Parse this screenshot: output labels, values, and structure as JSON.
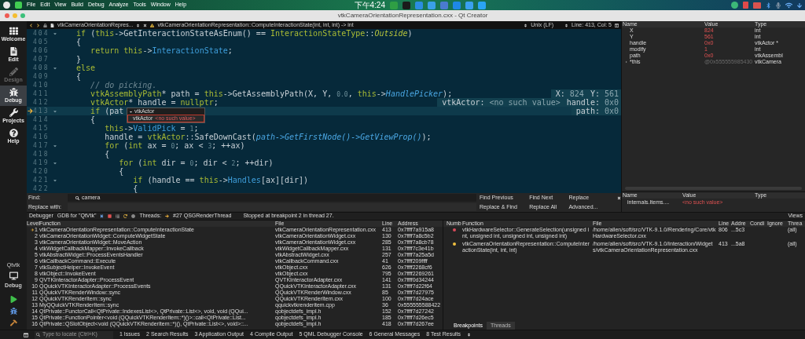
{
  "system_bar": {
    "menu": [
      "File",
      "Edit",
      "View",
      "Build",
      "Debug",
      "Analyze",
      "Tools",
      "Window",
      "Help"
    ],
    "clock": "下午4:24"
  },
  "window": {
    "title": "vtkCameraOrientationRepresentation.cxx - Qt Creator"
  },
  "modes": [
    {
      "label": "Welcome",
      "kind": "welcome",
      "selected": false,
      "disabled": false
    },
    {
      "label": "Edit",
      "kind": "edit",
      "selected": false,
      "disabled": false
    },
    {
      "label": "Design",
      "kind": "design",
      "selected": false,
      "disabled": true
    },
    {
      "label": "Debug",
      "kind": "debug",
      "selected": true,
      "disabled": false
    },
    {
      "label": "Projects",
      "kind": "projects",
      "selected": false,
      "disabled": false
    },
    {
      "label": "Help",
      "kind": "help",
      "selected": false,
      "disabled": false
    }
  ],
  "target": {
    "project": "Qtvtk",
    "config": "Debug"
  },
  "editor": {
    "file": "vtkCameraOrientationRepres...",
    "symbol": "vtkCameraOrientationRepresentation::ComputeInteractionState(int, int, int) -> int",
    "line_ending": "Unix (LF)",
    "position": "Line: 413, Col: 5",
    "lines": [
      {
        "number": "404",
        "fold": true,
        "tokens": [
          {
            "text": "   if",
            "kind": "keyword"
          },
          {
            "text": " (",
            "kind": "plain"
          },
          {
            "text": "this",
            "kind": "keyword"
          },
          {
            "text": "->GetInteractionStateAsEnum() == ",
            "kind": "plain"
          },
          {
            "text": "InteractionStateType",
            "kind": "type"
          },
          {
            "text": "::",
            "kind": "plain"
          },
          {
            "text": "Outside",
            "kind": "enum"
          },
          {
            "text": ")",
            "kind": "plain"
          }
        ]
      },
      {
        "number": "405",
        "fold": false,
        "tokens": [
          {
            "text": "   {",
            "kind": "plain"
          }
        ]
      },
      {
        "number": "406",
        "fold": false,
        "tokens": [
          {
            "text": "      return ",
            "kind": "keyword"
          },
          {
            "text": "this",
            "kind": "keyword"
          },
          {
            "text": "->",
            "kind": "plain"
          },
          {
            "text": "InteractionState",
            "kind": "member"
          },
          {
            "text": ";",
            "kind": "plain"
          }
        ]
      },
      {
        "number": "407",
        "fold": false,
        "tokens": [
          {
            "text": "   }",
            "kind": "plain"
          }
        ]
      },
      {
        "number": "408",
        "fold": true,
        "tokens": [
          {
            "text": "   else",
            "kind": "keyword"
          }
        ]
      },
      {
        "number": "409",
        "fold": false,
        "tokens": [
          {
            "text": "   {",
            "kind": "plain"
          }
        ]
      },
      {
        "number": "410",
        "fold": false,
        "tokens": [
          {
            "text": "      // do picking.",
            "kind": "comment"
          }
        ]
      },
      {
        "number": "411",
        "fold": false,
        "tokens": [
          {
            "text": "      vtkAssemblyPath",
            "kind": "type"
          },
          {
            "text": "* path = ",
            "kind": "plain"
          },
          {
            "text": "this",
            "kind": "keyword"
          },
          {
            "text": "->GetAssemblyPath(X, Y, ",
            "kind": "plain"
          },
          {
            "text": "0.0",
            "kind": "number"
          },
          {
            "text": ", ",
            "kind": "plain"
          },
          {
            "text": "this",
            "kind": "keyword"
          },
          {
            "text": "->",
            "kind": "plain"
          },
          {
            "text": "HandlePicker",
            "kind": "virtual"
          },
          {
            "text": ");",
            "kind": "plain"
          }
        ],
        "annotations": [
          {
            "label": "X:",
            "value": "824"
          },
          {
            "label": "Y:",
            "value": "561"
          }
        ]
      },
      {
        "number": "412",
        "fold": false,
        "tokens": [
          {
            "text": "      vtkActor",
            "kind": "type"
          },
          {
            "text": "* handle = ",
            "kind": "plain"
          },
          {
            "text": "nullptr",
            "kind": "keyword"
          },
          {
            "text": ";",
            "kind": "plain"
          }
        ],
        "annotations": [
          {
            "label": "vtkActor:",
            "value": "<no such value>"
          },
          {
            "label": "handle:",
            "value": "0x0"
          }
        ]
      },
      {
        "number": "413",
        "fold": true,
        "breakpoint": true,
        "current": true,
        "tokens": [
          {
            "text": "      if",
            "kind": "keyword"
          },
          {
            "text": " (pat",
            "kind": "plain"
          }
        ],
        "annotations": [
          {
            "label": "path:",
            "value": "0x0"
          }
        ],
        "popup": {
          "header": "vtkActor",
          "rows": [
            {
              "name": "vtkActor",
              "value": "<no such value>"
            }
          ]
        }
      },
      {
        "number": "414",
        "fold": false,
        "tokens": [
          {
            "text": "      {",
            "kind": "plain"
          }
        ]
      },
      {
        "number": "415",
        "fold": false,
        "tokens": [
          {
            "text": "         this",
            "kind": "keyword"
          },
          {
            "text": "->",
            "kind": "plain"
          },
          {
            "text": "ValidPick",
            "kind": "member"
          },
          {
            "text": " = ",
            "kind": "plain"
          },
          {
            "text": "1",
            "kind": "number"
          },
          {
            "text": ";",
            "kind": "plain"
          }
        ]
      },
      {
        "number": "416",
        "fold": false,
        "tokens": [
          {
            "text": "         handle = ",
            "kind": "plain"
          },
          {
            "text": "vtkActor",
            "kind": "type"
          },
          {
            "text": "::SafeDownCast(",
            "kind": "plain"
          },
          {
            "text": "path->GetFirstNode()->GetViewProp()",
            "kind": "virtual"
          },
          {
            "text": ");",
            "kind": "plain"
          }
        ]
      },
      {
        "number": "417",
        "fold": true,
        "tokens": [
          {
            "text": "         for",
            "kind": "keyword"
          },
          {
            "text": " (",
            "kind": "plain"
          },
          {
            "text": "int",
            "kind": "keyword"
          },
          {
            "text": " ax = ",
            "kind": "plain"
          },
          {
            "text": "0",
            "kind": "number"
          },
          {
            "text": "; ax < ",
            "kind": "plain"
          },
          {
            "text": "3",
            "kind": "number"
          },
          {
            "text": "; ++ax)",
            "kind": "plain"
          }
        ]
      },
      {
        "number": "418",
        "fold": false,
        "tokens": [
          {
            "text": "         {",
            "kind": "plain"
          }
        ]
      },
      {
        "number": "419",
        "fold": true,
        "tokens": [
          {
            "text": "            for",
            "kind": "keyword"
          },
          {
            "text": " (",
            "kind": "plain"
          },
          {
            "text": "int",
            "kind": "keyword"
          },
          {
            "text": " dir = ",
            "kind": "plain"
          },
          {
            "text": "0",
            "kind": "number"
          },
          {
            "text": "; dir < ",
            "kind": "plain"
          },
          {
            "text": "2",
            "kind": "number"
          },
          {
            "text": "; ++dir)",
            "kind": "plain"
          }
        ]
      },
      {
        "number": "420",
        "fold": false,
        "tokens": [
          {
            "text": "            {",
            "kind": "plain"
          }
        ]
      },
      {
        "number": "421",
        "fold": true,
        "tokens": [
          {
            "text": "               if",
            "kind": "keyword"
          },
          {
            "text": " (handle == ",
            "kind": "plain"
          },
          {
            "text": "this",
            "kind": "keyword"
          },
          {
            "text": "->",
            "kind": "plain"
          },
          {
            "text": "Handles",
            "kind": "member"
          },
          {
            "text": "[ax][dir])",
            "kind": "plain"
          }
        ]
      },
      {
        "number": "422",
        "fold": false,
        "tokens": [
          {
            "text": "               {",
            "kind": "plain"
          }
        ]
      }
    ]
  },
  "find": {
    "find_label": "Find:",
    "find_value": "camera",
    "replace_label": "Replace with:",
    "buttons": [
      "Find Previous",
      "Find Next",
      "Replace",
      "Replace & Find",
      "Replace All",
      "Advanced..."
    ]
  },
  "locals": {
    "columns": [
      "Name",
      "Value",
      "Type"
    ],
    "rows": [
      {
        "name": "X",
        "value": "824",
        "type": "int",
        "changed": true,
        "expandable": false
      },
      {
        "name": "Y",
        "value": "561",
        "type": "int",
        "changed": true,
        "expandable": false
      },
      {
        "name": "handle",
        "value": "0x0",
        "type": "vtkActor *",
        "changed": true,
        "expandable": false
      },
      {
        "name": "modify",
        "value": "1",
        "type": "int",
        "changed": true,
        "expandable": false
      },
      {
        "name": "path",
        "value": "0x0",
        "type": "vtkAssembl",
        "changed": true,
        "expandable": false
      },
      {
        "name": "*this",
        "value": "@0x555555985430",
        "type": "vtkCamera",
        "changed": false,
        "expandable": true
      }
    ]
  },
  "watch": {
    "columns": [
      "Name",
      "Value",
      "Type"
    ],
    "rows": [
      {
        "name": "internals.Items....",
        "value": "<no such value>",
        "type": ""
      }
    ]
  },
  "debug_toolbar": {
    "engine": "Debugger",
    "kit": "GDB for \"QtVtk\"",
    "threads_label": "Threads:",
    "thread": "#27 QSGRenderThread",
    "status": "Stopped at breakpoint 2 in thread 27.",
    "views": "Views"
  },
  "stack": {
    "columns": [
      "Level",
      "Function",
      "File",
      "Line",
      "Address"
    ],
    "rows": [
      {
        "level": "1",
        "function": "vtkCameraOrientationRepresentation::ComputeInteractionState",
        "file": "vtkCameraOrientationRepresentation.cxx",
        "line": "413",
        "address": "0x7ffff7a915a8",
        "current": true
      },
      {
        "level": "2",
        "function": "vtkCameraOrientationWidget::ComputeWidgetState",
        "file": "vtkCameraOrientationWidget.cxx",
        "line": "130",
        "address": "0x7ffff7a8c5b2",
        "current": false
      },
      {
        "level": "3",
        "function": "vtkCameraOrientationWidget::MoveAction",
        "file": "vtkCameraOrientationWidget.cxx",
        "line": "285",
        "address": "0x7ffff7a8cb78",
        "current": false
      },
      {
        "level": "4",
        "function": "vtkWidgetCallbackMapper::InvokeCallback",
        "file": "vtkWidgetCallbackMapper.cxx",
        "line": "131",
        "address": "0x7ffff7c3e41b",
        "current": false
      },
      {
        "level": "5",
        "function": "vtkAbstractWidget::ProcessEventsHandler",
        "file": "vtkAbstractWidget.cxx",
        "line": "257",
        "address": "0x7ffff7a25a5d",
        "current": false
      },
      {
        "level": "6",
        "function": "vtkCallbackCommand::Execute",
        "file": "vtkCallbackCommand.cxx",
        "line": "41",
        "address": "0x7ffff209ffff",
        "current": false
      },
      {
        "level": "7",
        "function": "vtkSubjectHelper::InvokeEvent",
        "file": "vtkObject.cxx",
        "line": "626",
        "address": "0x7ffff2268cf6",
        "current": false
      },
      {
        "level": "8",
        "function": "vtkObject::InvokeEvent",
        "file": "vtkObject.cxx",
        "line": "795",
        "address": "0x7ffff2269261",
        "current": false
      },
      {
        "level": "9",
        "function": "QVTKInteractorAdapter::ProcessEvent",
        "file": "QVTKInteractorAdapter.cxx",
        "line": "141",
        "address": "0x7ffff0d34244",
        "current": false
      },
      {
        "level": "10",
        "function": "QQuickVTKInteractorAdapter::ProcessEvents",
        "file": "QQuickVTKInteractorAdapter.cxx",
        "line": "131",
        "address": "0x7ffff7d22f64",
        "current": false
      },
      {
        "level": "11",
        "function": "QQuickVTKRenderWindow::sync",
        "file": "QQuickVTKRenderWindow.cxx",
        "line": "85",
        "address": "0x7ffff7d27975",
        "current": false
      },
      {
        "level": "12",
        "function": "QQuickVTKRenderItem::sync",
        "file": "QQuickVTKRenderItem.cxx",
        "line": "100",
        "address": "0x7ffff7d24ace",
        "current": false
      },
      {
        "level": "13",
        "function": "MyQQuickVTKRenderItem::sync",
        "file": "qquickvtkrenderitem.cpp",
        "line": "36",
        "address": "0x555555588422",
        "current": false
      },
      {
        "level": "14",
        "function": "QtPrivate::FunctorCall<QtPrivate::IndexesList<>, QtPrivate::List<>, void, void (QQui...",
        "file": "qobjectdefs_impl.h",
        "line": "152",
        "address": "0x7ffff7d27242",
        "current": false
      },
      {
        "level": "15",
        "function": "QtPrivate::FunctionPointer<void (QQuickVTKRenderItem::*)()>::call<QtPrivate::List...",
        "file": "qobjectdefs_impl.h",
        "line": "185",
        "address": "0x7ffff7d26ec5",
        "current": false
      },
      {
        "level": "16",
        "function": "QtPrivate::QSlotObject<void (QQuickVTKRenderItem::*)(), QtPrivate::List<>, void>::...",
        "file": "qobjectdefs_impl.h",
        "line": "418",
        "address": "0x7ffff7d267ee",
        "current": false
      }
    ]
  },
  "breakpoints": {
    "columns": [
      "Numb",
      "Function",
      "File",
      "Line",
      "Addre",
      "Condi",
      "Ignore",
      "Threa"
    ],
    "rows": [
      {
        "function": "vtkHardwareSelector::GenerateSelection(unsigned int, unsigned int, unsigned int, unsigned int)",
        "file": "/home/allen/soft/src/VTK-9.1.0/Rendering/Core/vtkHardwareSelector.cxx",
        "line": "806",
        "address": "...5c3",
        "threads": "(all)",
        "hit": false
      },
      {
        "function": "vtkCameraOrientationRepresentation::ComputeInteractionState(int, int, int)",
        "file": "/home/allen/soft/src/VTK-9.1.0/Interaction/Widgets/vtkCameraOrientationRepresentation.cxx",
        "line": "413",
        "address": "...5a8",
        "threads": "(all)",
        "hit": true
      }
    ],
    "tabs": [
      {
        "label": "Breakpoints",
        "selected": true
      },
      {
        "label": "Threads",
        "selected": false
      }
    ]
  },
  "status_bar": {
    "locator_placeholder": "Type to locate (Ctrl+K)",
    "panes": [
      "1 Issues",
      "2 Search Results",
      "3 Application Output",
      "4 Compile Output",
      "5 QML Debugger Console",
      "6 General Messages",
      "8 Test Results"
    ]
  }
}
